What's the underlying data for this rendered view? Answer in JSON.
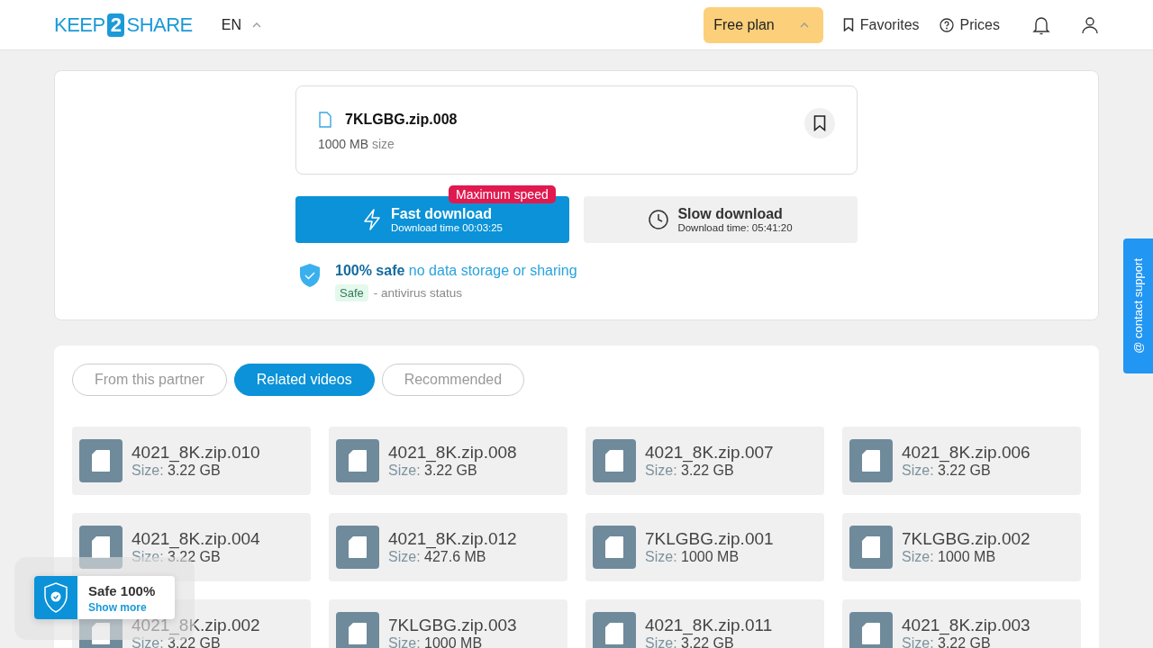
{
  "header": {
    "logo": {
      "left": "KEEP",
      "mark": "2",
      "right": "SHARE"
    },
    "language": "EN",
    "plan": "Free plan",
    "nav": [
      {
        "kind": "favorites",
        "label": "Favorites"
      },
      {
        "kind": "prices",
        "label": "Prices"
      }
    ]
  },
  "file": {
    "name": "7KLGBG.zip.008",
    "size": "1000 MB",
    "size_suffix": "size",
    "bookmarked": false
  },
  "downloads": [
    {
      "kind": "fast",
      "title": "Fast download",
      "subtitle": "Download time 00:03:25",
      "badge": "Maximum speed"
    },
    {
      "kind": "slow",
      "title": "Slow download",
      "subtitle": "Download time: 05:41:20"
    }
  ],
  "safety": {
    "text": "**100% safe** no data storage or sharing",
    "status": "Safe",
    "status_note": "- antivirus status"
  },
  "tabs": [
    {
      "label": "From this partner",
      "selected": false
    },
    {
      "label": "Related videos",
      "selected": true
    },
    {
      "label": "Recommended",
      "selected": false
    }
  ],
  "files": [
    {
      "name": "4021_8K.zip.010",
      "size_label": "Size:",
      "size": "3.22 GB"
    },
    {
      "name": "4021_8K.zip.008",
      "size_label": "Size:",
      "size": "3.22 GB"
    },
    {
      "name": "4021_8K.zip.007",
      "size_label": "Size:",
      "size": "3.22 GB"
    },
    {
      "name": "4021_8K.zip.006",
      "size_label": "Size:",
      "size": "3.22 GB"
    },
    {
      "name": "4021_8K.zip.004",
      "size_label": "Size:",
      "size": "3.22 GB"
    },
    {
      "name": "4021_8K.zip.012",
      "size_label": "Size:",
      "size": "427.6 MB"
    },
    {
      "name": "7KLGBG.zip.001",
      "size_label": "Size:",
      "size": "1000 MB"
    },
    {
      "name": "7KLGBG.zip.002",
      "size_label": "Size:",
      "size": "1000 MB"
    },
    {
      "name": "4021_8K.zip.002",
      "size_label": "Size:",
      "size": "3.22 GB"
    },
    {
      "name": "7KLGBG.zip.003",
      "size_label": "Size:",
      "size": "1000 MB"
    },
    {
      "name": "4021_8K.zip.011",
      "size_label": "Size:",
      "size": "3.22 GB"
    },
    {
      "name": "4021_8K.zip.003",
      "size_label": "Size:",
      "size": "3.22 GB"
    }
  ],
  "support": "@ contact support",
  "safe_badge": {
    "title": "Safe 100%",
    "link": "Show more"
  }
}
